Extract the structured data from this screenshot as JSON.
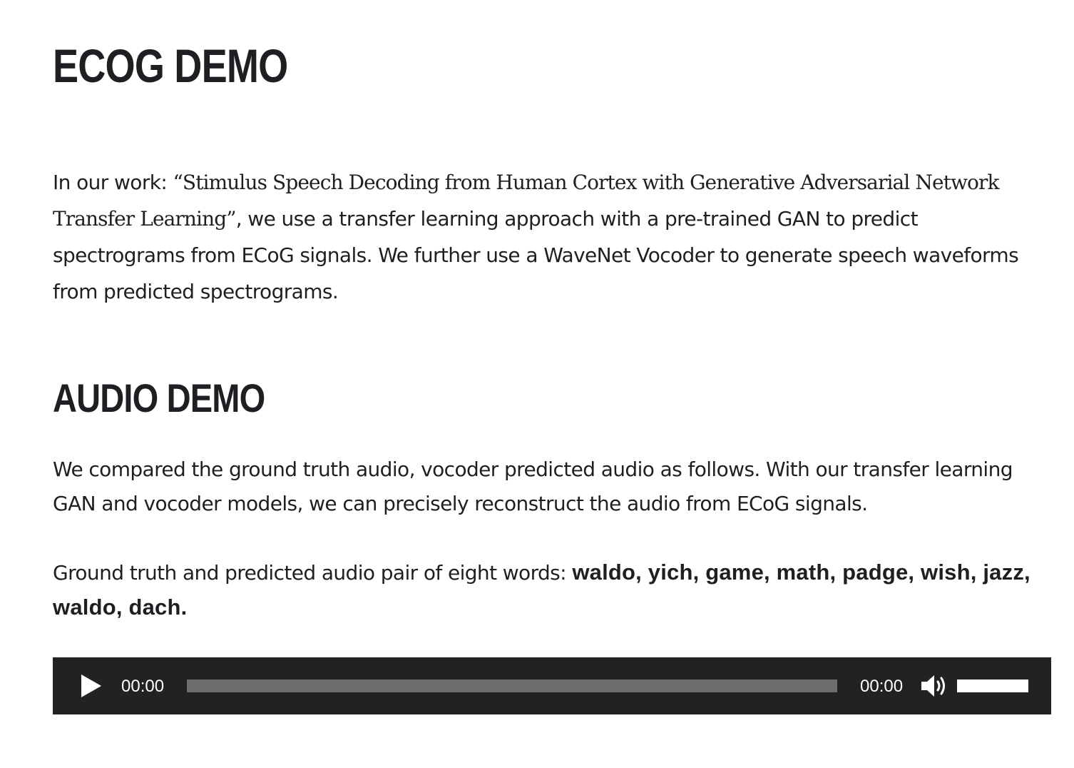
{
  "headings": {
    "ecog_demo": "ECOG DEMO",
    "audio_demo": "AUDIO DEMO"
  },
  "intro": {
    "prefix": "In our work: ",
    "paper_title": "“Stimulus Speech Decoding from Human Cortex with Generative Adversarial Network Transfer Learning”",
    "body": ", we use a transfer learning approach with a pre-trained GAN to predict spectrograms from ECoG signals. We further use a WaveNet Vocoder to generate speech waveforms from predicted spectrograms."
  },
  "audio_section": {
    "comparison": "We compared the ground truth audio, vocoder predicted audio as follows. With our transfer learning GAN and vocoder models, we can precisely reconstruct the audio from ECoG signals.",
    "pairs_prefix": "Ground truth and predicted audio pair of eight words: ",
    "pairs_words": "waldo, yich, game, math, padge, wish, jazz, waldo, dach."
  },
  "player": {
    "current_time": "00:00",
    "duration": "00:00",
    "progress": 0,
    "volume": 1.0,
    "colors": {
      "background": "#222222",
      "rail": "#6d6d6d",
      "foreground": "#ffffff"
    },
    "icons": {
      "play": "play-icon",
      "volume": "speaker-icon"
    }
  }
}
